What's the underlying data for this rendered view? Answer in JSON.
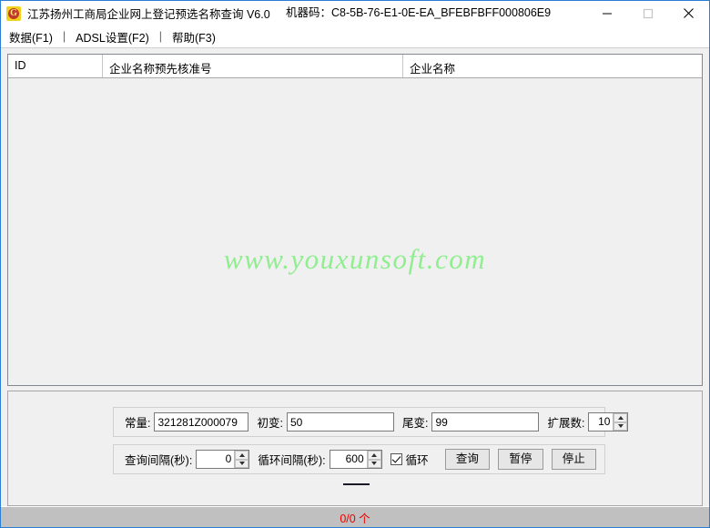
{
  "window": {
    "title": "江苏扬州工商局企业网上登记预选名称查询 V6.0",
    "machine_code_label": "机器码：C8-5B-76-E1-0E-EA_BFEBFBFF000806E9",
    "app_icon": "devil-mascot-icon",
    "icon_letter": "G",
    "controls": {
      "minimize": "minimize-icon",
      "maximize": "maximize-icon",
      "close": "close-icon"
    },
    "border_color": "#2a7fd4"
  },
  "menubar": {
    "items": [
      {
        "label": "数据(F1)"
      },
      {
        "label": "ADSL设置(F2)"
      },
      {
        "label": "帮助(F3)"
      }
    ],
    "separator": "|"
  },
  "grid": {
    "columns": [
      {
        "key": "id",
        "label": "ID"
      },
      {
        "key": "pre_approval_no",
        "label": "企业名称预先核准号"
      },
      {
        "key": "company_name",
        "label": "企业名称"
      }
    ],
    "rows": [],
    "watermark": "www.youxunsoft.com",
    "watermark_color": "#90ee90"
  },
  "controls": {
    "row1": {
      "const_label": "常量:",
      "const_value": "321281Z000079",
      "start_label": "初变:",
      "start_value": "50",
      "end_label": "尾变:",
      "end_value": "99",
      "expand_label": "扩展数:",
      "expand_value": "10"
    },
    "row2": {
      "query_interval_label": "查询间隔(秒):",
      "query_interval_value": "0",
      "loop_interval_label": "循环间隔(秒):",
      "loop_interval_value": "600",
      "loop_checkbox_label": "循环",
      "loop_checked": true,
      "query_button": "查询",
      "pause_button": "暂停",
      "stop_button": "停止"
    }
  },
  "statusbar": {
    "count_text": "0/0 个",
    "count_color": "#ee0000"
  }
}
